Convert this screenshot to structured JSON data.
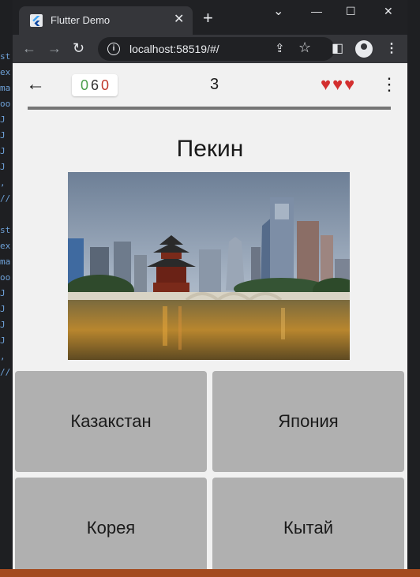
{
  "browser": {
    "tab_title": "Flutter Demo",
    "tab_close": "✕",
    "new_tab": "+",
    "url": "localhost:58519/#/",
    "controls": {
      "chevron": "⌄",
      "minimize": "—",
      "maximize": "☐",
      "close": "✕"
    }
  },
  "app": {
    "score": {
      "correct": "0",
      "total": "6",
      "wrong": "0"
    },
    "round": "3",
    "lives": 3,
    "hearts": "♥♥♥",
    "progress": 1.0,
    "city": "Пекин",
    "answers": [
      "Казакстан",
      "Япония",
      "Корея",
      "Кытай"
    ]
  },
  "editor": {
    "lines": [
      "st",
      "ex",
      "ma",
      "oo",
      "J",
      "J",
      "J",
      "J",
      ",",
      "//",
      "st",
      "ex",
      "ma",
      "oo",
      "J",
      "J",
      "J",
      "J",
      ",",
      "//"
    ]
  },
  "colors": {
    "heart": "#d32f2f",
    "answer_bg": "#b0b0b0",
    "app_bg": "#f1f1f1"
  }
}
